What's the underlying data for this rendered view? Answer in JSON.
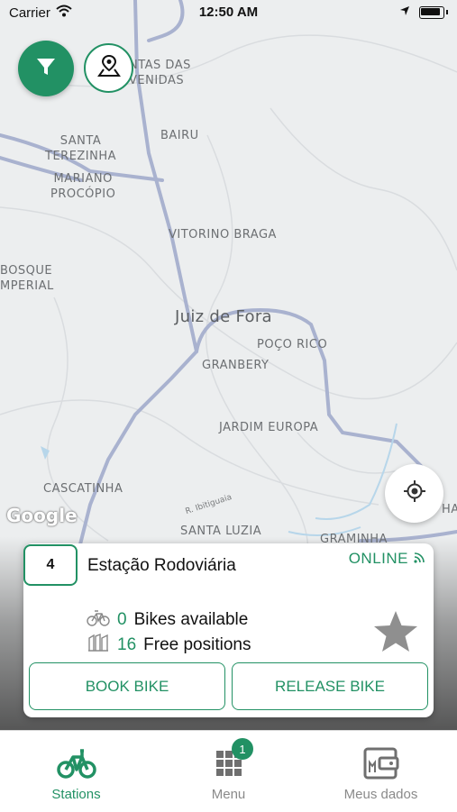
{
  "status_bar": {
    "carrier": "Carrier",
    "time": "12:50 AM"
  },
  "map": {
    "labels": {
      "santas_das_venidas": "NTAS DAS\nVENIDAS",
      "bairu": "BAIRU",
      "santa_terezinha": "SANTA\nTEREZINHA",
      "mariano_procopio": "MARIANO\nPROCÓPIO",
      "vitorino_braga": "VITORINO BRAGA",
      "bosque_imperial": "BOSQUE\nMPERIAL",
      "juiz_de_fora": "Juiz de Fora",
      "poco_rico": "POÇO RICO",
      "granbery": "GRANBERY",
      "jardim_europa": "JARDIM EUROPA",
      "cascatinha": "CASCATINHA",
      "r_ibitiguaia": "R. Ibitiguaia",
      "santa_luzia": "SANTA LUZIA",
      "graminha": "GRAMINHA",
      "ha": "HA"
    },
    "attribution": "Google"
  },
  "station_card": {
    "number": "4",
    "name": "Estação Rodoviária",
    "status": "ONLINE",
    "bikes_available_count": "0",
    "bikes_available_label": "Bikes available",
    "free_positions_count": "16",
    "free_positions_label": "Free positions",
    "book_button": "BOOK BIKE",
    "release_button": "RELEASE BIKE"
  },
  "tabbar": {
    "tabs": [
      {
        "label": "Stations",
        "icon": "bicycle-icon",
        "active": true
      },
      {
        "label": "Menu",
        "icon": "grid-icon",
        "active": false,
        "badge": "1"
      },
      {
        "label": "Meus dados",
        "icon": "wallet-icon",
        "active": false
      }
    ]
  },
  "colors": {
    "accent": "#229164",
    "map_bg": "#eceeef",
    "road": "#a9b2cf"
  }
}
